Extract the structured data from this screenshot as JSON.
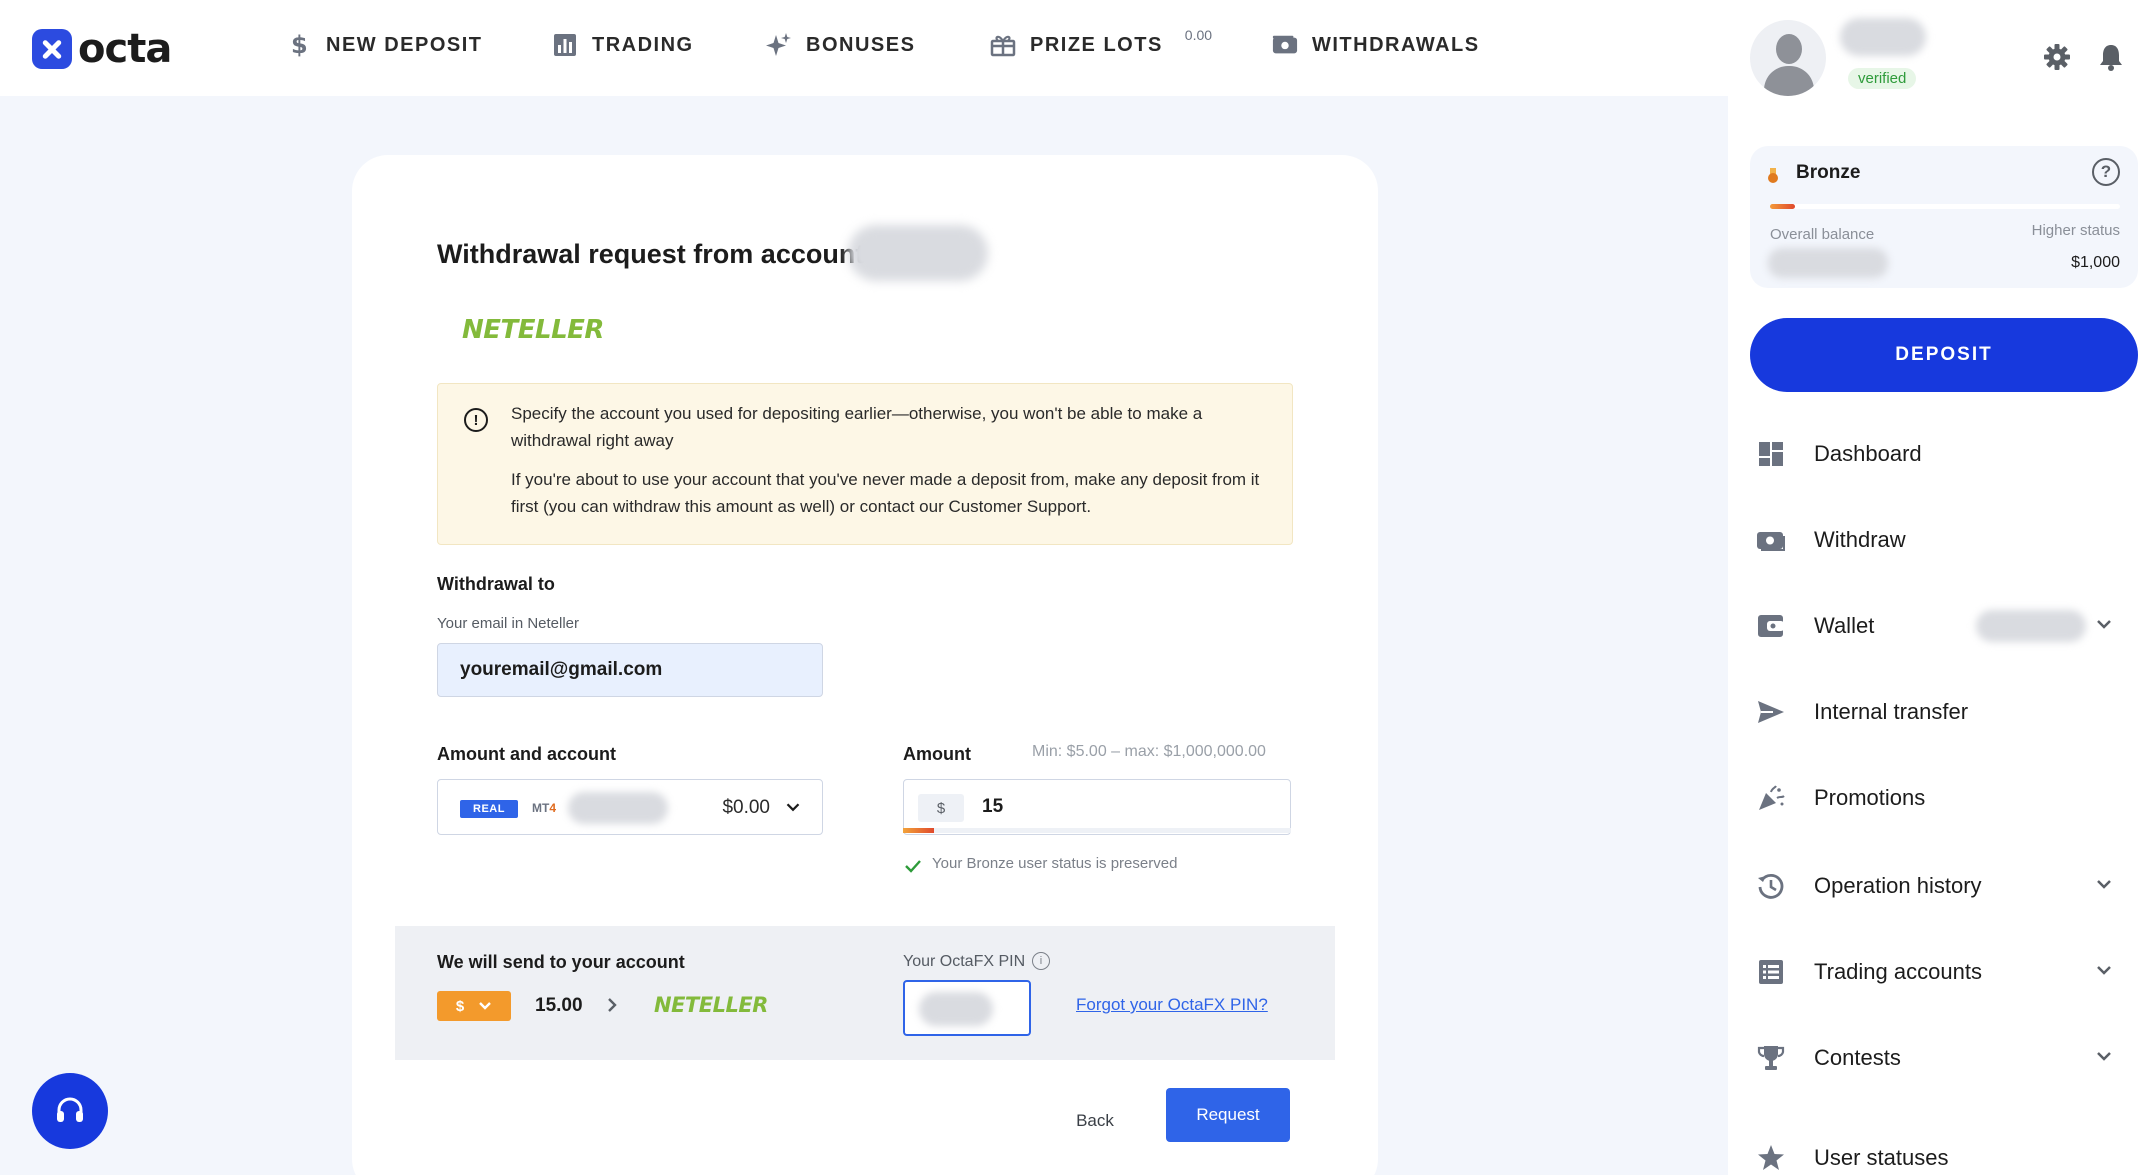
{
  "brand": {
    "name": "octa",
    "color": "#2c4be0"
  },
  "nav": {
    "items": [
      {
        "label": "NEW DEPOSIT",
        "icon": "dollar-icon"
      },
      {
        "label": "TRADING",
        "icon": "chart-icon"
      },
      {
        "label": "BONUSES",
        "icon": "sparkle-icon"
      },
      {
        "label": "PRIZE LOTS",
        "icon": "gift-icon",
        "badge": "0.00"
      },
      {
        "label": "WITHDRAWALS",
        "icon": "wallet-icon"
      }
    ]
  },
  "user": {
    "verified_label": "verified"
  },
  "status": {
    "name": "Bronze",
    "progress": 0.07,
    "overall_label": "Overall balance",
    "higher_label": "Higher status",
    "higher_value": "$1,000"
  },
  "sidebar": {
    "deposit_label": "DEPOSIT",
    "menu": [
      {
        "label": "Dashboard",
        "icon": "dashboard-icon",
        "expandable": false
      },
      {
        "label": "Withdraw",
        "icon": "withdraw-icon",
        "expandable": false
      },
      {
        "label": "Wallet",
        "icon": "wallet-icon",
        "expandable": true
      },
      {
        "label": "Internal transfer",
        "icon": "send-icon",
        "expandable": false
      },
      {
        "label": "Promotions",
        "icon": "party-icon",
        "expandable": false
      },
      {
        "label": "Operation history",
        "icon": "history-icon",
        "expandable": true
      },
      {
        "label": "Trading accounts",
        "icon": "list-icon",
        "expandable": true
      },
      {
        "label": "Contests",
        "icon": "trophy-icon",
        "expandable": true
      },
      {
        "label": "User statuses",
        "icon": "star-icon",
        "expandable": false
      }
    ]
  },
  "form": {
    "title": "Withdrawal request from account",
    "method_logo": "NETELLER",
    "notice": {
      "p1": "Specify the account you used for depositing earlier—otherwise, you won't be able to make a withdrawal right away",
      "p2": "If you're about to use your account that you've never made a deposit from, make any deposit from it first (you can withdraw this amount as well) or contact our Customer Support."
    },
    "withdrawal_to_label": "Withdrawal to",
    "email_label": "Your email in Neteller",
    "email_value": "youremail@gmail.com",
    "amount_account_label": "Amount and account",
    "account": {
      "type": "REAL",
      "platform": "MT",
      "platform_version": "4",
      "balance": "$0.00"
    },
    "amount_label": "Amount",
    "amount_limits": "Min: $5.00 – max: $1,000,000.00",
    "currency_symbol": "$",
    "amount_value": "15",
    "amount_progress": 0.08,
    "status_note": "Your Bronze user status is preserved",
    "send_label": "We will send to your account",
    "send_currency": "$",
    "send_amount": "15.00",
    "pin_label": "Your OctaFX PIN",
    "forgot_pin": "Forgot your OctaFX PIN?",
    "back_label": "Back",
    "request_label": "Request"
  }
}
